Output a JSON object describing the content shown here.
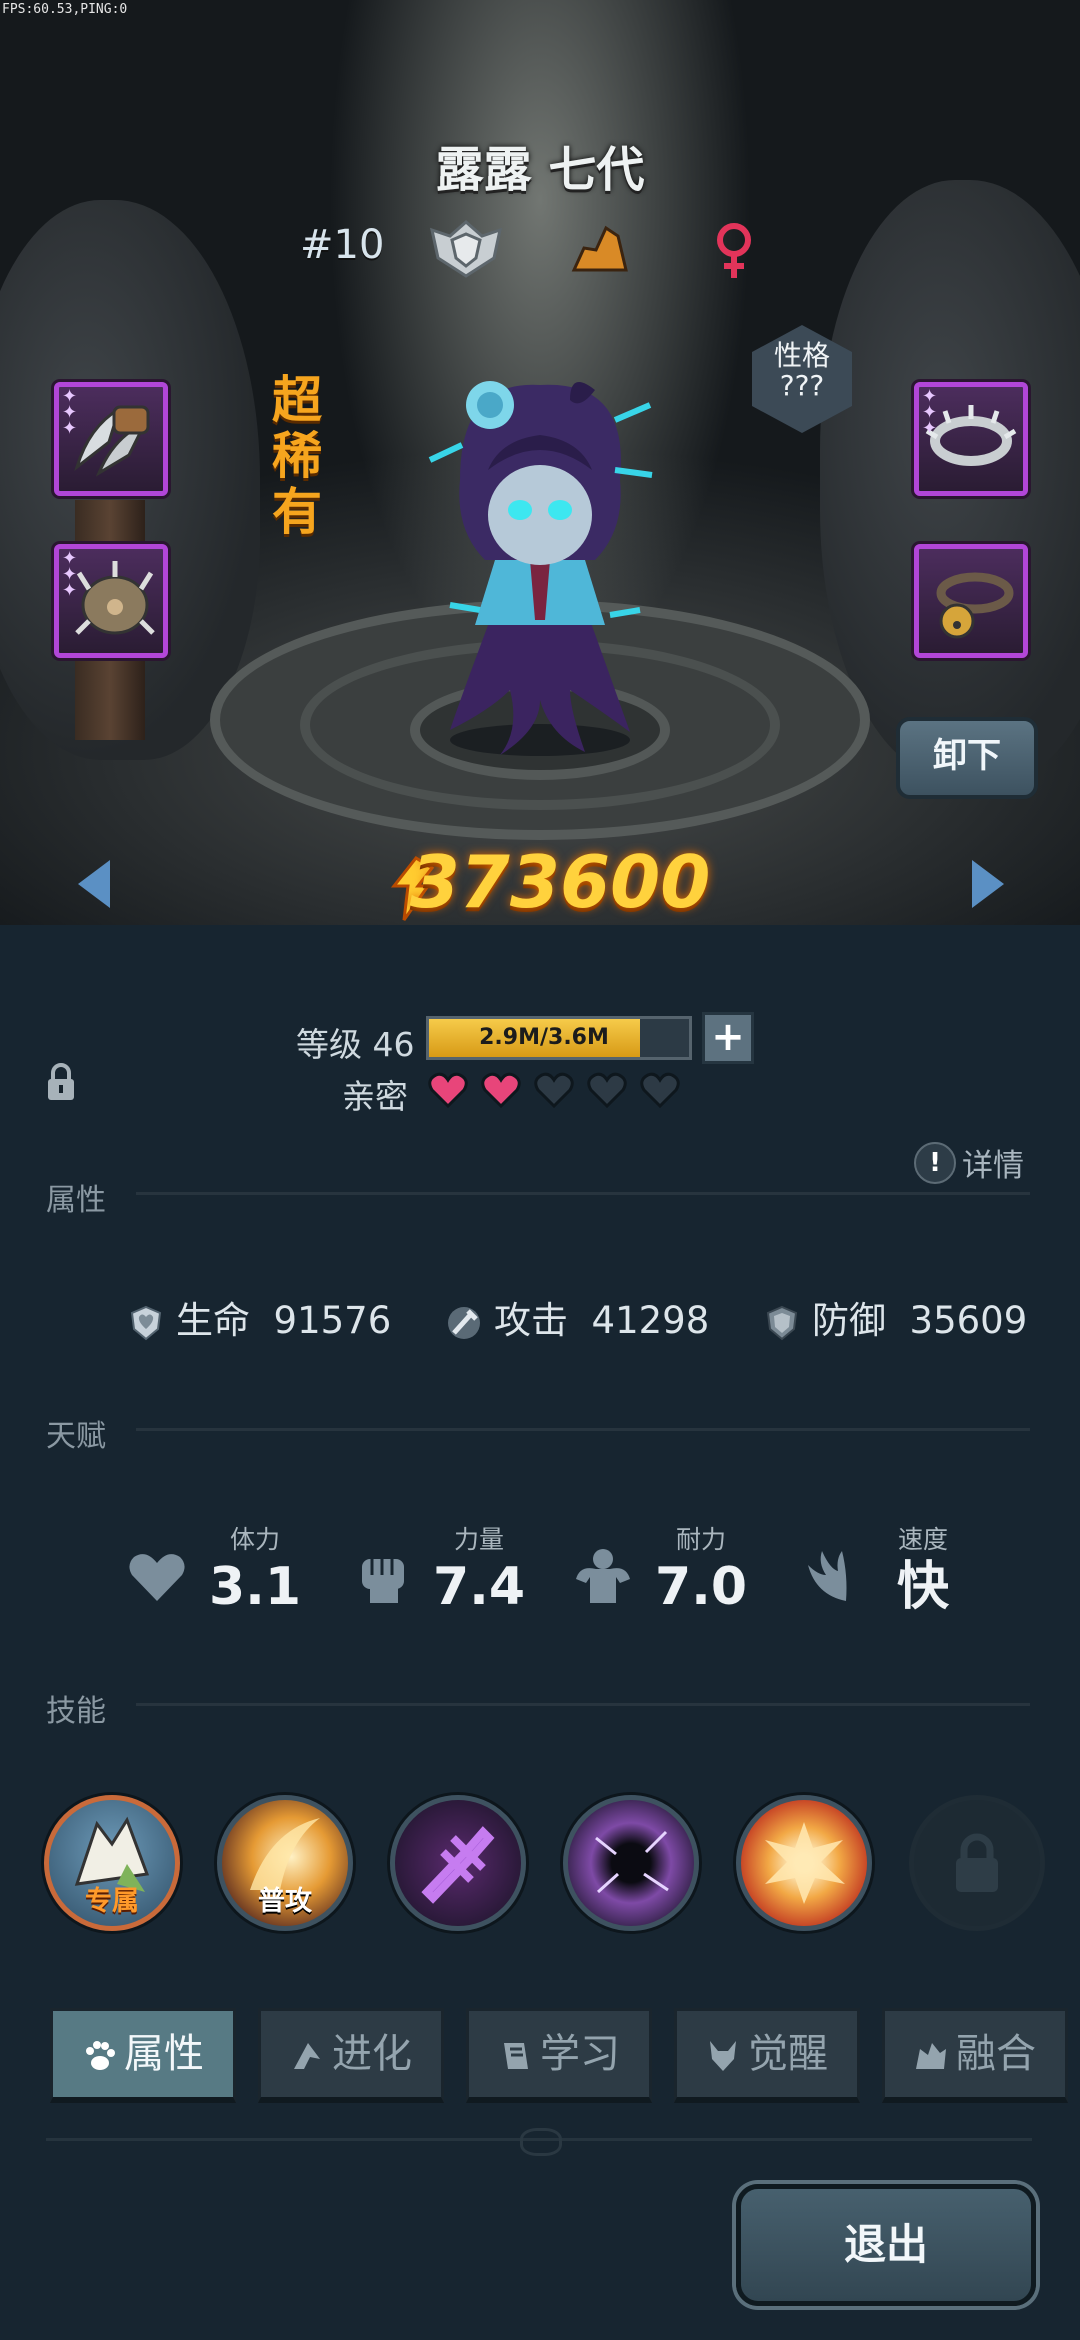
{
  "debug": {
    "fps_text": "FPS:60.53,PING:0"
  },
  "character": {
    "name": "露露 七代",
    "rank": "#10",
    "rarity": "超稀有",
    "trait_label": "性格",
    "trait_value": "???",
    "power": "373600",
    "icons": [
      "shield-rank-icon",
      "terrain-icon",
      "female-icon"
    ]
  },
  "equipment": {
    "left": [
      {
        "name": "claw-weapon",
        "icon": "claw-icon"
      },
      {
        "name": "spiked-armor",
        "icon": "spiked-helmet-icon"
      }
    ],
    "right": [
      {
        "name": "spiked-collar",
        "icon": "collar-icon"
      },
      {
        "name": "bell-collar",
        "icon": "bell-collar-icon"
      }
    ],
    "unequip_label": "卸下"
  },
  "level": {
    "label": "等级 46",
    "xp_text": "2.9M/3.6M",
    "xp_fraction": 0.81
  },
  "intimacy": {
    "label": "亲密",
    "filled": 2,
    "total": 5
  },
  "details_label": "详情",
  "sections": {
    "attributes": "属性",
    "talent": "天赋",
    "skills": "技能"
  },
  "stats": [
    {
      "label": "生命",
      "value": "91576",
      "icon": "heart-shield-icon"
    },
    {
      "label": "攻击",
      "value": "41298",
      "icon": "sword-icon"
    },
    {
      "label": "防御",
      "value": "35609",
      "icon": "shield-icon"
    }
  ],
  "talents": [
    {
      "label": "体力",
      "value": "3.1",
      "icon": "heart-icon"
    },
    {
      "label": "力量",
      "value": "7.4",
      "icon": "fist-icon"
    },
    {
      "label": "耐力",
      "value": "7.0",
      "icon": "muscle-icon"
    },
    {
      "label": "速度",
      "value": "快",
      "icon": "wing-icon"
    }
  ],
  "skills": [
    {
      "tag": "专属",
      "icon": "exclusive-skill-icon"
    },
    {
      "tag": "普攻",
      "icon": "basic-attack-icon"
    },
    {
      "tag": "",
      "icon": "shadow-claw-icon"
    },
    {
      "tag": "",
      "icon": "dark-vortex-icon"
    },
    {
      "tag": "",
      "icon": "explosion-icon"
    },
    {
      "tag": "",
      "icon": "locked-slot-icon"
    }
  ],
  "tabs": [
    {
      "label": "属性",
      "icon": "paw-icon",
      "active": true
    },
    {
      "label": "进化",
      "icon": "evolve-arrow-icon",
      "active": false
    },
    {
      "label": "学习",
      "icon": "book-icon",
      "active": false
    },
    {
      "label": "觉醒",
      "icon": "beast-head-icon",
      "active": false
    },
    {
      "label": "融合",
      "icon": "fusion-icon",
      "active": false
    }
  ],
  "exit_label": "退出",
  "colors": {
    "rarity": "#f6a51e",
    "power": "#ffd23d",
    "heart_filled": "#e8457a",
    "heart_empty": "#2d3a45",
    "equipment_border": "#b246d8"
  }
}
